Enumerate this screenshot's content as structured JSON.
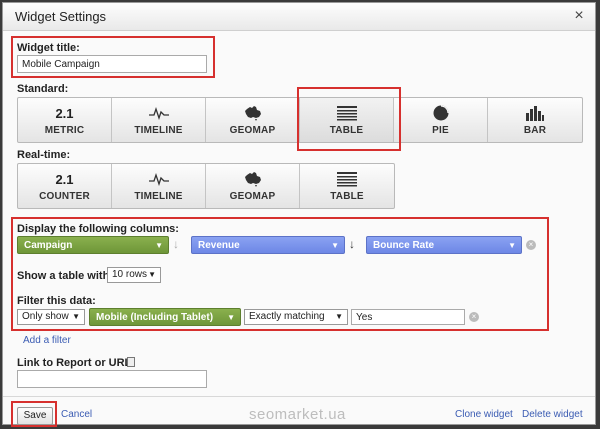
{
  "dialog": {
    "title": "Widget Settings",
    "close_symbol": "×"
  },
  "widget_title": {
    "label": "Widget title:",
    "value": "Mobile Campaign"
  },
  "standard": {
    "label": "Standard:",
    "buttons": [
      {
        "icon_text": "2.1",
        "caption": "METRIC",
        "icon": "metric-icon"
      },
      {
        "icon_text": "",
        "caption": "TIMELINE",
        "icon": "timeline-icon"
      },
      {
        "icon_text": "",
        "caption": "GEOMAP",
        "icon": "geomap-icon"
      },
      {
        "icon_text": "",
        "caption": "TABLE",
        "icon": "table-icon",
        "selected": true
      },
      {
        "icon_text": "",
        "caption": "PIE",
        "icon": "pie-icon"
      },
      {
        "icon_text": "",
        "caption": "BAR",
        "icon": "bar-icon"
      }
    ]
  },
  "realtime": {
    "label": "Real-time:",
    "buttons": [
      {
        "icon_text": "2.1",
        "caption": "COUNTER",
        "icon": "counter-icon"
      },
      {
        "icon_text": "",
        "caption": "TIMELINE",
        "icon": "timeline-icon"
      },
      {
        "icon_text": "",
        "caption": "GEOMAP",
        "icon": "geomap-icon"
      },
      {
        "icon_text": "",
        "caption": "TABLE",
        "icon": "table-icon"
      }
    ]
  },
  "columns": {
    "label": "Display the following columns:",
    "dimension": "Campaign",
    "metric1": "Revenue",
    "metric2": "Bounce Rate",
    "arrow_light": "↓",
    "arrow_dark": "↓"
  },
  "show_table": {
    "label": "Show a table with",
    "rows_value": "10 rows"
  },
  "filter": {
    "label": "Filter this data:",
    "mode": "Only show",
    "dimension": "Mobile (Including Tablet)",
    "match": "Exactly matching",
    "value": "Yes",
    "add_filter": "Add a filter"
  },
  "link": {
    "label": "Link to Report or URL:",
    "value": ""
  },
  "footer": {
    "save": "Save",
    "cancel": "Cancel",
    "clone": "Clone widget",
    "delete": "Delete widget",
    "watermark": "seomarket.ua"
  },
  "colors": {
    "highlight_red": "#d6302e",
    "dropdown_green": "#7aa241",
    "dropdown_blue": "#7892ec",
    "link_blue": "#3b5cb3"
  }
}
